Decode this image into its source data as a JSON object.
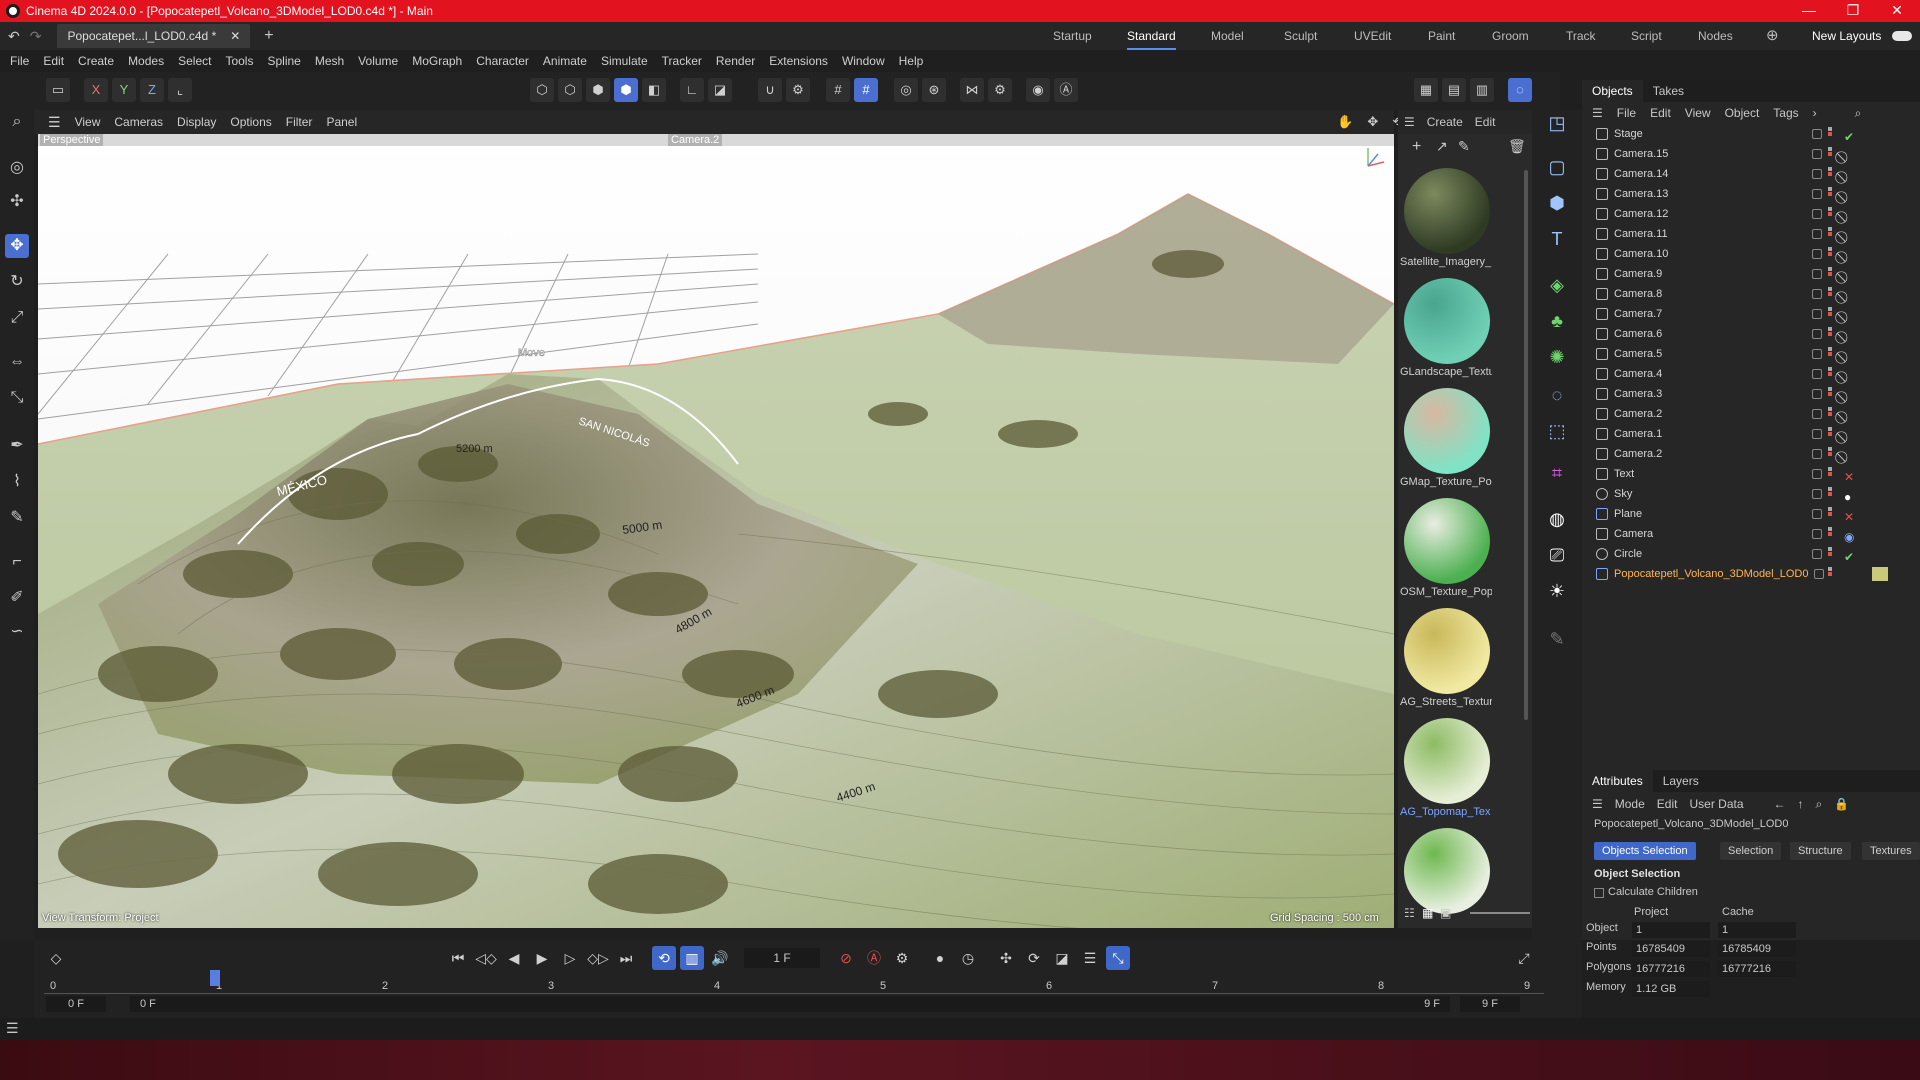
{
  "window": {
    "title": "Cinema 4D 2024.0.0 - [Popocatepetl_Volcano_3DModel_LOD0.c4d *] - Main",
    "minimize": "—",
    "maximize": "❐",
    "close": "✕"
  },
  "tabs": {
    "document_tab": "Popocatepet...l_LOD0.c4d *",
    "layouts": [
      "Startup",
      "Standard",
      "Model",
      "Sculpt",
      "UVEdit",
      "Paint",
      "Groom",
      "Track",
      "Script",
      "Nodes"
    ],
    "active_layout": "Standard",
    "new_layouts": "New Layouts"
  },
  "menubar": [
    "File",
    "Edit",
    "Create",
    "Modes",
    "Select",
    "Tools",
    "Spline",
    "Mesh",
    "Volume",
    "MoGraph",
    "Character",
    "Animate",
    "Simulate",
    "Tracker",
    "Render",
    "Extensions",
    "Window",
    "Help"
  ],
  "axes": {
    "x": "X",
    "y": "Y",
    "z": "Z"
  },
  "viewport": {
    "menu": [
      "View",
      "Cameras",
      "Display",
      "Options",
      "Filter",
      "Panel"
    ],
    "projection": "Perspective",
    "camera": "Camera.2",
    "mode": "Move",
    "view_transform": "View Transform: Project",
    "grid_spacing": "Grid Spacing : 500 cm",
    "labels": [
      "5200 m",
      "SAN NICOLÁS",
      "MÉXICO",
      "5000 m",
      "4800 m",
      "4600 m",
      "4400 m"
    ]
  },
  "materials": {
    "menu": [
      "Create",
      "Edit"
    ],
    "items": [
      {
        "name": "Satellite_Imagery_",
        "c1": "#2f3a23",
        "c2": "#7c8a5e"
      },
      {
        "name": "GLandscape_Textu",
        "c1": "#6fd0b5",
        "c2": "#4aa48f"
      },
      {
        "name": "GMap_Texture_Po",
        "c1": "#7fe3c6",
        "c2": "#d8b8a0"
      },
      {
        "name": "OSM_Texture_Pop",
        "c1": "#4cb050",
        "c2": "#e9ede2"
      },
      {
        "name": "AG_Streets_Textur",
        "c1": "#f1e9a2",
        "c2": "#c9b85a"
      },
      {
        "name": "AG_Topomap_Tex",
        "c1": "#e7eed6",
        "c2": "#8dbb64"
      },
      {
        "name": "",
        "c1": "#e8efe0",
        "c2": "#6fb850"
      }
    ],
    "selected": "AG_Topomap_Tex"
  },
  "objects": {
    "tabs": [
      "Objects",
      "Takes"
    ],
    "menu": [
      "File",
      "Edit",
      "View",
      "Object",
      "Tags"
    ],
    "items": [
      "Stage",
      "Camera.15",
      "Camera.14",
      "Camera.13",
      "Camera.12",
      "Camera.11",
      "Camera.10",
      "Camera.9",
      "Camera.8",
      "Camera.7",
      "Camera.6",
      "Camera.5",
      "Camera.4",
      "Camera.3",
      "Camera.2",
      "Camera.1",
      "Camera.2",
      "Text",
      "Sky",
      "Plane",
      "Camera",
      "Circle",
      "Popocatepetl_Volcano_3DModel_LOD0"
    ]
  },
  "attributes": {
    "tabs": [
      "Attributes",
      "Layers"
    ],
    "menu": [
      "Mode",
      "Edit",
      "User Data"
    ],
    "object_name": "Popocatepetl_Volcano_3DModel_LOD0",
    "buttons": [
      "Objects Selection",
      "Selection",
      "Structure",
      "Textures"
    ],
    "section": "Object Selection",
    "calc_children": "Calculate Children",
    "col_project": "Project",
    "col_cache": "Cache",
    "rows": [
      {
        "label": "Object",
        "project": "1",
        "cache": "1"
      },
      {
        "label": "Points",
        "project": "16785409",
        "cache": "16785409"
      },
      {
        "label": "Polygons",
        "project": "16777216",
        "cache": "16777216"
      },
      {
        "label": "Memory",
        "project": "1.12 GB",
        "cache": ""
      }
    ]
  },
  "timeline": {
    "current_frame": "1 F",
    "ticks": [
      "0",
      "1",
      "2",
      "3",
      "4",
      "5",
      "6",
      "7",
      "8",
      "9"
    ],
    "start": "0 F",
    "start2": "0 F",
    "end": "9 F",
    "end2": "9 F"
  }
}
